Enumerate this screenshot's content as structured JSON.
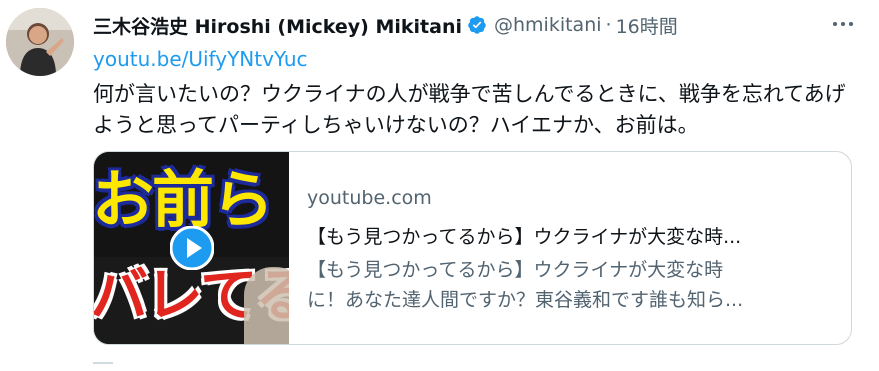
{
  "author": {
    "display_name": "三木谷浩史 Hiroshi (Mickey) Mikitani",
    "handle": "@hmikitani",
    "separator": "·",
    "timestamp": "16時間"
  },
  "tweet": {
    "link": "youtu.be/UifyYNtvYuc",
    "text": "何が言いたいの？ウクライナの人が戦争で苦しんでるときに、戦争を忘れてあげようと思ってパーティしちゃいけないの？ハイエナか、お前は。"
  },
  "card": {
    "domain": "youtube.com",
    "title": "【もう見つかってるから】ウクライナが大変な時...",
    "description_line1": "【もう見つかってるから】ウクライナが大変な時",
    "description_line2": "に！あなた達人間ですか？東谷義和です誰も知ら...",
    "thumbnail_text_top": "お前ら",
    "thumbnail_text_bottom": "バレてる"
  },
  "icons": {
    "verified": "verified-badge-icon",
    "more": "more-options-icon",
    "play": "play-icon"
  },
  "colors": {
    "link": "#1d9bf0",
    "secondary_text": "#536471",
    "border": "#cfd9de"
  }
}
